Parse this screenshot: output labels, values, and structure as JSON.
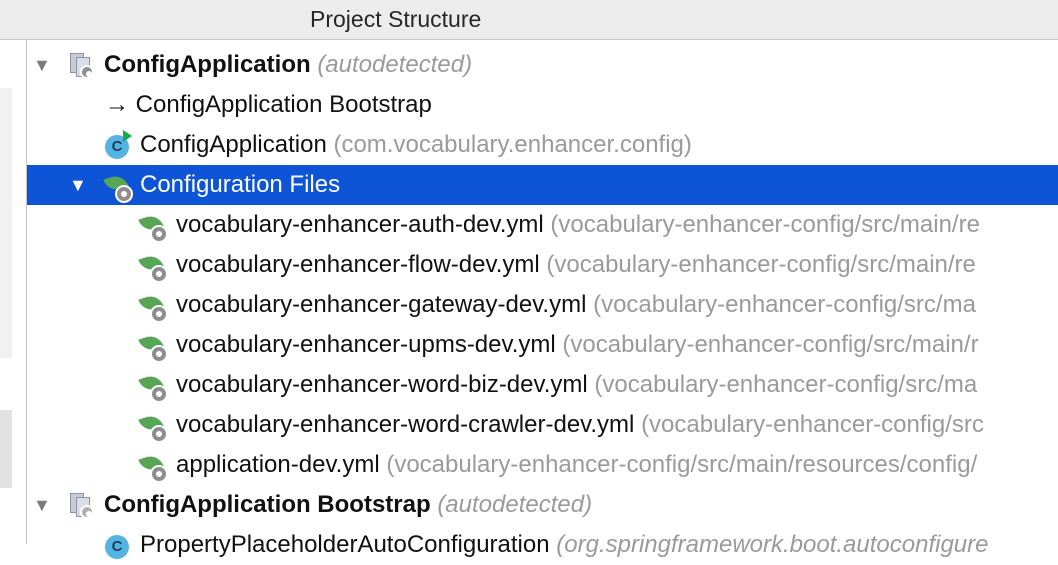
{
  "window": {
    "title": "Project Structure"
  },
  "tree": {
    "rows": [
      {
        "name": "ConfigApplication",
        "suffix": "(autodetected)"
      },
      {
        "prefix": "→",
        "name": "ConfigApplication Bootstrap"
      },
      {
        "name": "ConfigApplication",
        "path": "(com.vocabulary.enhancer.config)"
      },
      {
        "name": "Configuration Files"
      },
      {
        "name": "vocabulary-enhancer-auth-dev.yml",
        "path": "(vocabulary-enhancer-config/src/main/re"
      },
      {
        "name": "vocabulary-enhancer-flow-dev.yml",
        "path": "(vocabulary-enhancer-config/src/main/re"
      },
      {
        "name": "vocabulary-enhancer-gateway-dev.yml",
        "path": "(vocabulary-enhancer-config/src/ma"
      },
      {
        "name": "vocabulary-enhancer-upms-dev.yml",
        "path": "(vocabulary-enhancer-config/src/main/r"
      },
      {
        "name": "vocabulary-enhancer-word-biz-dev.yml",
        "path": "(vocabulary-enhancer-config/src/ma"
      },
      {
        "name": "vocabulary-enhancer-word-crawler-dev.yml",
        "path": "(vocabulary-enhancer-config/src"
      },
      {
        "name": "application-dev.yml",
        "path": "(vocabulary-enhancer-config/src/main/resources/config/"
      },
      {
        "name": "ConfigApplication Bootstrap",
        "suffix": "(autodetected)"
      },
      {
        "name": "PropertyPlaceholderAutoConfiguration",
        "path": "(org.springframework.boot.autoconfigure"
      }
    ]
  },
  "colors": {
    "selection": "#0d55d6",
    "spring_green": "#57a657",
    "class_blue": "#55b3e3"
  },
  "icons": {
    "expanded": "triangle-down-icon",
    "module": "module-icon",
    "spring_config": "spring-leaf-icon",
    "class": "class-icon",
    "arrow": "arrow-right-icon"
  }
}
